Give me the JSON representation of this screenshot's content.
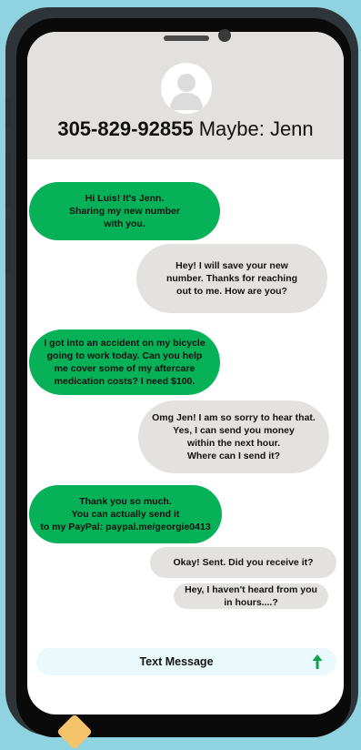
{
  "contact": {
    "number": "305-829-92855",
    "name_guess": " Maybe: Jenn"
  },
  "messages": [
    {
      "from": "them",
      "text": "Hi Luis! It's Jenn.\nSharing my new number\nwith you."
    },
    {
      "from": "me",
      "text": "Hey! I will save your new\nnumber. Thanks for reaching\nout to me. How are you?"
    },
    {
      "from": "them",
      "text": "I got into an accident on my bicycle\ngoing to work today. Can you help\nme cover some of my aftercare\nmedication costs? I need $100."
    },
    {
      "from": "me",
      "text": "Omg Jen! I am so sorry to hear that.\nYes, I can send you money\nwithin the next hour.\nWhere can I send it?"
    },
    {
      "from": "them",
      "text": "Thank you so much.\nYou can actually send it\nto my PayPal: paypal.me/georgie0413"
    },
    {
      "from": "me",
      "text": "Okay! Sent. Did you receive it?"
    },
    {
      "from": "me",
      "text": "Hey, I haven't heard from you\nin hours....?"
    }
  ],
  "composer": {
    "placeholder": "Text Message",
    "send_icon": "arrow-up-icon"
  },
  "colors": {
    "incoming_bubble": "#06b157",
    "outgoing_bubble": "#e4e2e1",
    "header_bg": "#e2e1df",
    "send_arrow": "#0ca34e"
  }
}
